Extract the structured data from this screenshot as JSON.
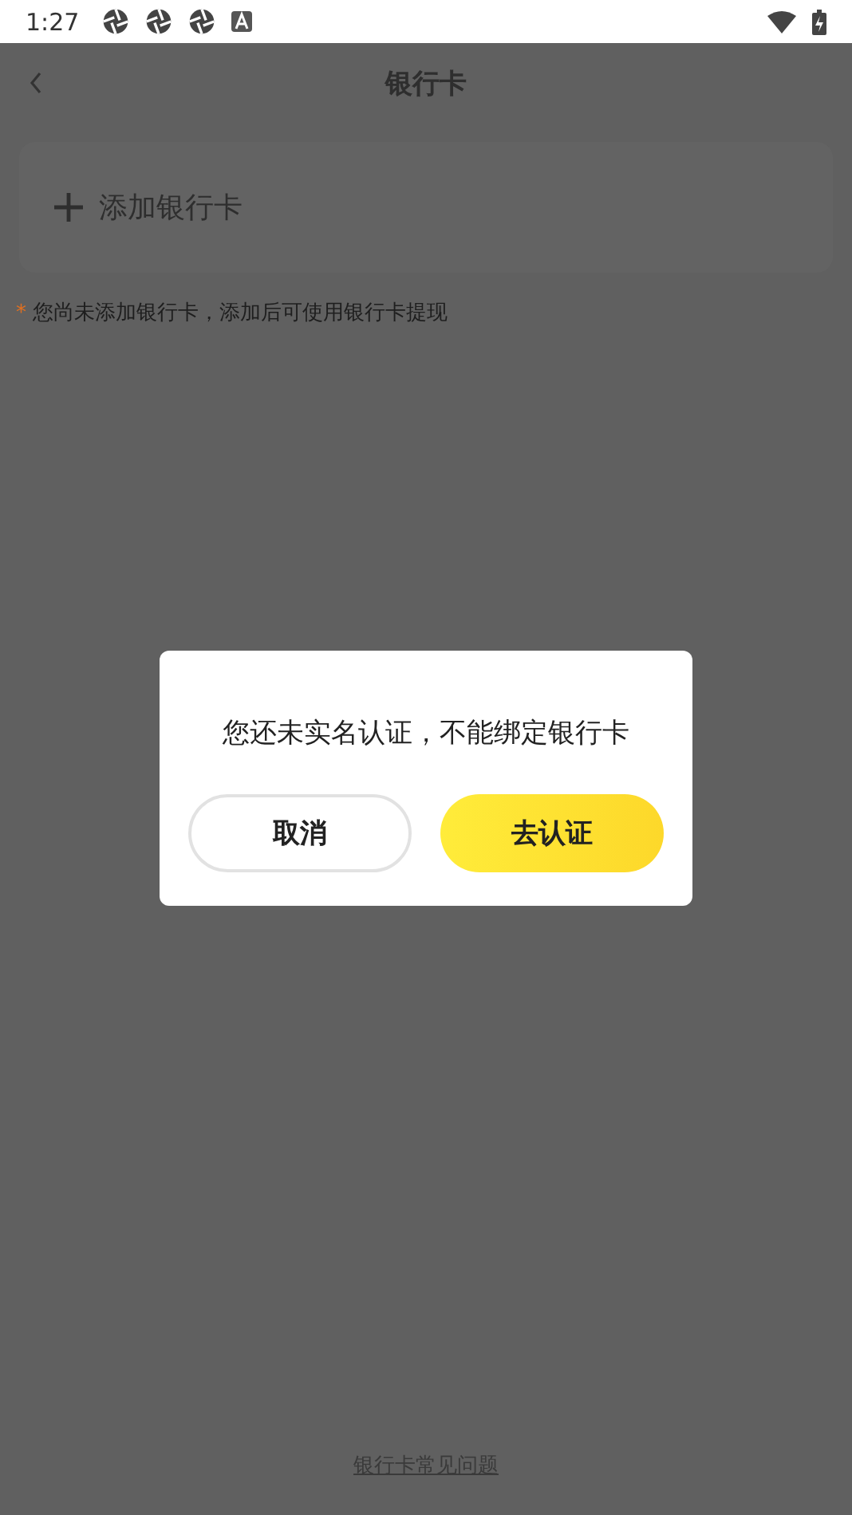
{
  "status_bar": {
    "time": "1:27"
  },
  "header": {
    "title": "银行卡"
  },
  "add_card": {
    "label": "添加银行卡"
  },
  "note": {
    "marker": "*",
    "text": "您尚未添加银行卡，添加后可使用银行卡提现"
  },
  "footer_link": "银行卡常见问题",
  "dialog": {
    "message": "您还未实名认证，不能绑定银行卡",
    "buttons": [
      {
        "label": "取消",
        "kind": "secondary"
      },
      {
        "label": "去认证",
        "kind": "primary"
      }
    ]
  }
}
